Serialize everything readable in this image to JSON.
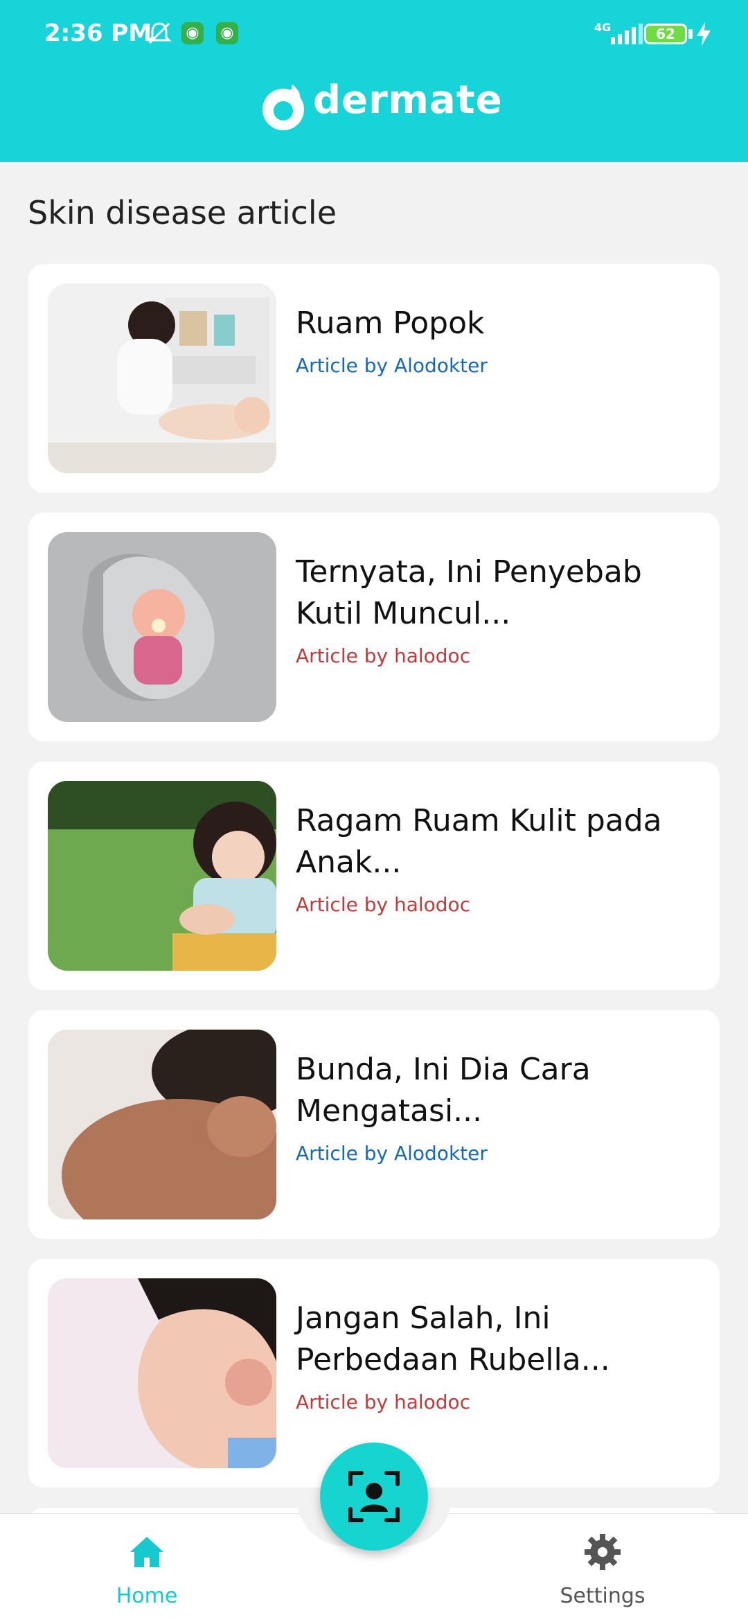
{
  "status_bar": {
    "time": "2:36 PM",
    "network": "4G",
    "battery": "62",
    "icons": [
      "mute-icon",
      "app-icon",
      "app-icon",
      "signal-icon",
      "battery-icon",
      "charging-icon"
    ]
  },
  "app_bar": {
    "brand": "dermate",
    "logo_icon": "dermate-logo-icon"
  },
  "section_title": "Skin disease article",
  "articles": [
    {
      "title": "Ruam Popok",
      "author": "Article by Alodokter",
      "source_color": "#1769b8"
    },
    {
      "title": "Ternyata, Ini Penyebab Kutil Muncul...",
      "author": "Article by halodoc",
      "source_color": "#c23a3a"
    },
    {
      "title": "Ragam Ruam Kulit pada Anak...",
      "author": "Article by halodoc",
      "source_color": "#c23a3a"
    },
    {
      "title": "Bunda, Ini Dia Cara Mengatasi...",
      "author": "Article by Alodokter",
      "source_color": "#1769b8"
    },
    {
      "title": "Jangan Salah, Ini Perbedaan Rubella...",
      "author": "Article by halodoc",
      "source_color": "#c23a3a"
    }
  ],
  "bottom_nav": {
    "home": {
      "label": "Home",
      "icon": "home-icon"
    },
    "scan": {
      "icon": "face-scan-icon"
    },
    "settings": {
      "label": "Settings",
      "icon": "gear-icon"
    }
  },
  "colors": {
    "primary": "#16d4d8",
    "background": "#f2f2f2"
  }
}
